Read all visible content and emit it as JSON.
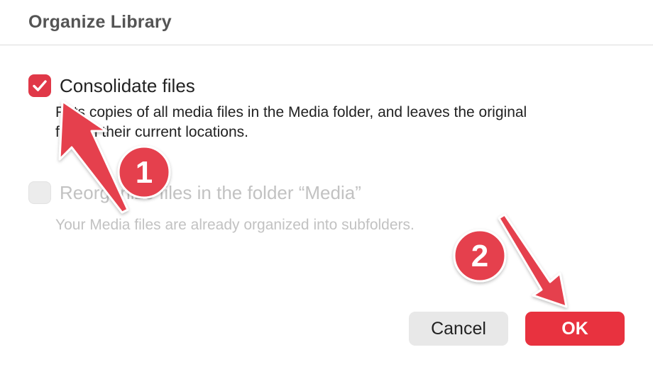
{
  "dialog": {
    "title": "Organize Library"
  },
  "options": [
    {
      "label": "Consolidate files",
      "description_line1": "Puts copies of all media files in the Media folder, and leaves the original",
      "description_line2": "files in their current locations.",
      "checked": true,
      "enabled": true
    },
    {
      "label": "Reorganize files in the folder “Media”",
      "description_line1": "Your Media files are already organized into subfolders.",
      "checked": false,
      "enabled": false
    }
  ],
  "buttons": {
    "cancel_label": "Cancel",
    "ok_label": "OK"
  },
  "annotations": {
    "badge1": "1",
    "badge2": "2",
    "color": "#e5414e"
  },
  "colors": {
    "accent": "#e03848",
    "ok_button": "#e8323f"
  }
}
